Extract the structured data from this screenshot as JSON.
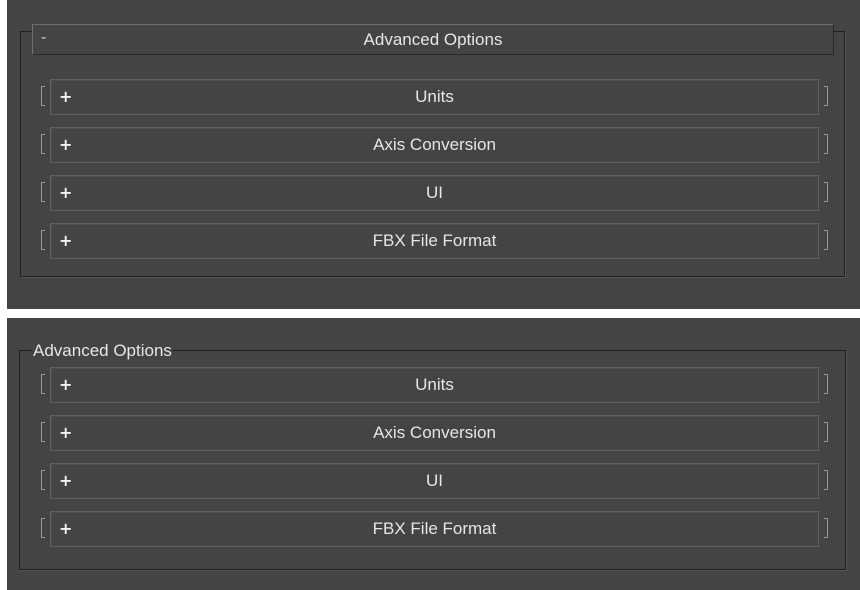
{
  "top_panel": {
    "header": {
      "collapse_sign": "-",
      "title": "Advanced Options"
    },
    "items": [
      {
        "sign": "+",
        "label": "Units"
      },
      {
        "sign": "+",
        "label": "Axis Conversion"
      },
      {
        "sign": "+",
        "label": "UI"
      },
      {
        "sign": "+",
        "label": "FBX File Format"
      }
    ]
  },
  "bottom_panel": {
    "group_title": "Advanced Options",
    "items": [
      {
        "sign": "+",
        "label": "Units"
      },
      {
        "sign": "+",
        "label": "Axis Conversion"
      },
      {
        "sign": "+",
        "label": "UI"
      },
      {
        "sign": "+",
        "label": "FBX File Format"
      }
    ]
  },
  "colors": {
    "panel_bg": "#444444",
    "separator": "#ffffff",
    "text": "#e6e6e6",
    "frame_dark": "#1f1f1f"
  }
}
